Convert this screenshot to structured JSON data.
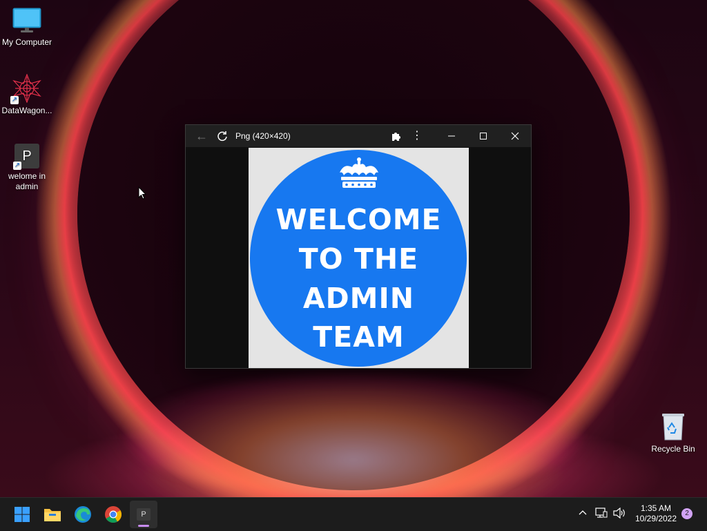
{
  "desktop": {
    "icons": [
      {
        "label": "My Computer"
      },
      {
        "label": "DataWagon..."
      },
      {
        "label": "welome in admin",
        "glyph": "P"
      },
      {
        "label": "Recycle Bin"
      }
    ]
  },
  "window": {
    "title": "Png (420×420)",
    "image": {
      "lines": [
        "WELCOME",
        "TO THE",
        "ADMIN",
        "TEAM"
      ]
    }
  },
  "taskbar": {
    "apps": [
      {
        "name": "start",
        "icon": "windows-logo-icon"
      },
      {
        "name": "file-explorer",
        "icon": "folder-icon"
      },
      {
        "name": "edge",
        "icon": "edge-icon"
      },
      {
        "name": "chrome",
        "icon": "chrome-icon"
      },
      {
        "name": "p-app",
        "icon": "p-app-icon",
        "glyph": "P"
      }
    ],
    "time": "1:35 AM",
    "date": "10/29/2022",
    "notification_count": "2"
  },
  "colors": {
    "accent_blue": "#1778f0",
    "taskbar_bg": "#1c1c1c",
    "active_indicator": "#c88cf3",
    "notification_badge": "#d1a3f5"
  }
}
